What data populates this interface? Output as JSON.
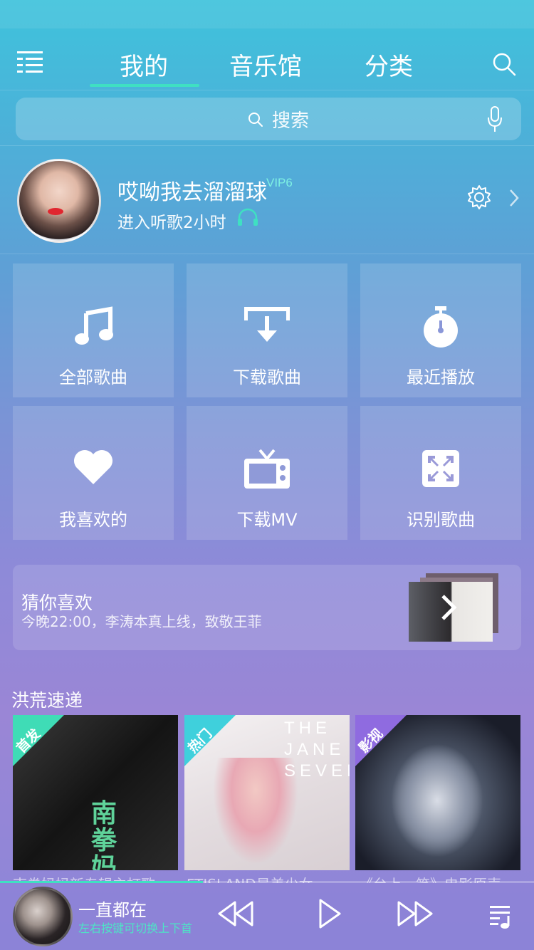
{
  "nav": {
    "tabs": [
      {
        "label": "我的",
        "active": true
      },
      {
        "label": "音乐馆",
        "active": false
      },
      {
        "label": "分类",
        "active": false
      }
    ],
    "menu_icon": "menu-icon",
    "search_icon": "search-icon",
    "accent_color": "#3fe0c2"
  },
  "search": {
    "placeholder": "搜索",
    "mic_icon": "microphone-icon"
  },
  "profile": {
    "username": "哎呦我去溜溜球",
    "vip": "VIP6",
    "listen_text": "进入听歌2小时",
    "settings_icon": "gear-icon"
  },
  "grid": [
    {
      "label": "全部歌曲",
      "icon": "music-note-icon"
    },
    {
      "label": "下载歌曲",
      "icon": "download-icon"
    },
    {
      "label": "最近播放",
      "icon": "stopwatch-icon"
    },
    {
      "label": "我喜欢的",
      "icon": "heart-icon"
    },
    {
      "label": "下载MV",
      "icon": "tv-icon"
    },
    {
      "label": "识别歌曲",
      "icon": "scan-icon"
    }
  ],
  "recommend": {
    "title": "猜你喜欢",
    "subtitle": "今晚22:00，李涛本真上线，致敬王菲"
  },
  "express": {
    "title": "洪荒速递",
    "albums": [
      {
        "tag": "首发",
        "tag_color": "#3fdcb6",
        "cover_text": "南拳妈妈",
        "caption": "南拳妈妈新专辑主打歌"
      },
      {
        "tag": "热门",
        "tag_color": "#3fd0dc",
        "cover_text": "THE JANE SEVENTH",
        "caption": "FTISLAND最美少女"
      },
      {
        "tag": "影视",
        "tag_color": "#8f6be0",
        "cover_text": "",
        "caption": "《台上一笑》电影原声"
      }
    ]
  },
  "player": {
    "song": "一直都在",
    "hint": "左右按键可切换上下首",
    "progress": 0.38
  }
}
